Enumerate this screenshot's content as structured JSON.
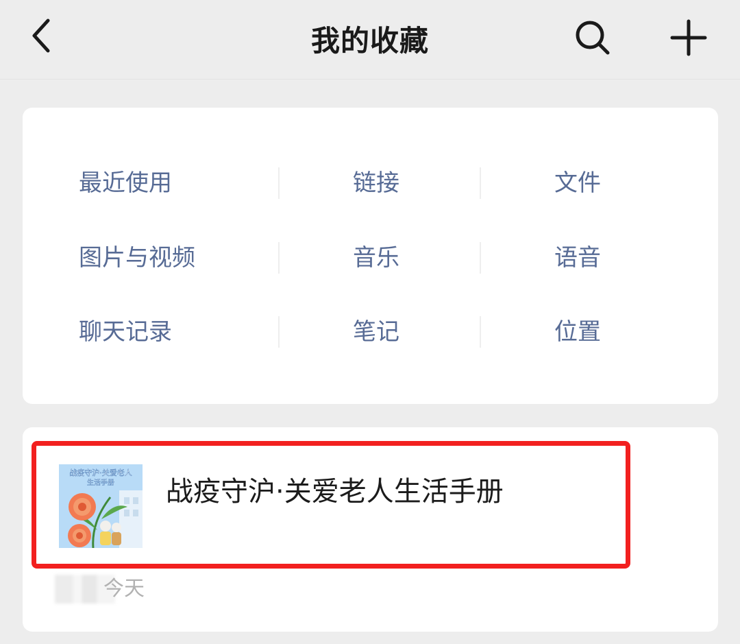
{
  "header": {
    "title": "我的收藏",
    "icons": {
      "back": "chevron-left-icon",
      "search": "search-icon",
      "add": "plus-icon"
    }
  },
  "categories": {
    "rows": [
      [
        "最近使用",
        "链接",
        "文件"
      ],
      [
        "图片与视频",
        "音乐",
        "语音"
      ],
      [
        "聊天记录",
        "笔记",
        "位置"
      ]
    ]
  },
  "favorite": {
    "title": "战疫守沪·关爱老人生活手册",
    "time": "今天",
    "thumbnail_text_line1": "战疫守沪·关爱老人",
    "thumbnail_text_line2": "生活手册"
  },
  "colors": {
    "background": "#ededed",
    "category_text": "#576b95",
    "highlight_border": "#f2201f"
  }
}
